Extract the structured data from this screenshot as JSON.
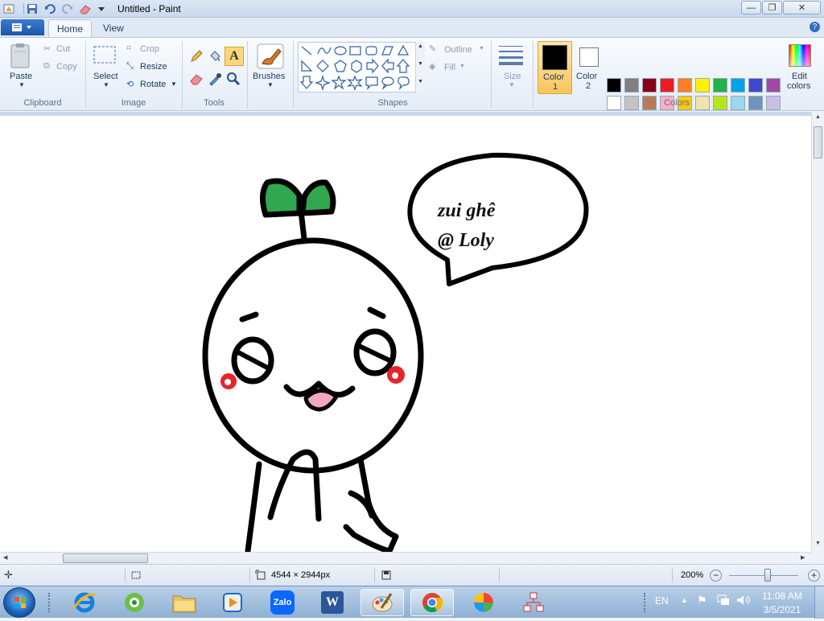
{
  "window": {
    "title": "Untitled - Paint",
    "controls": {
      "minimize": "—",
      "maximize": "❐",
      "close": "✕"
    }
  },
  "tabs": [
    {
      "label": "Home",
      "active": true
    },
    {
      "label": "View",
      "active": false
    }
  ],
  "ribbon": {
    "clipboard": {
      "group": "Clipboard",
      "paste": "Paste",
      "cut": "Cut",
      "copy": "Copy"
    },
    "image": {
      "group": "Image",
      "select": "Select",
      "crop": "Crop",
      "resize": "Resize",
      "rotate": "Rotate"
    },
    "tools": {
      "group": "Tools"
    },
    "brushes": {
      "label": "Brushes"
    },
    "shapes": {
      "group": "Shapes",
      "outline": "Outline",
      "fill": "Fill"
    },
    "size": {
      "label": "Size"
    },
    "colors": {
      "group": "Colors",
      "color1_line1": "Color",
      "color1_line2": "1",
      "color2_line1": "Color",
      "color2_line2": "2",
      "edit_line1": "Edit",
      "edit_line2": "colors",
      "color1": "#000000",
      "color2": "#ffffff",
      "palette_row1": [
        "#000000",
        "#7f7f7f",
        "#880015",
        "#ed1c24",
        "#ff7f27",
        "#fff200",
        "#22b14c",
        "#00a2e8",
        "#3f48cc",
        "#a349a4"
      ],
      "palette_row2": [
        "#ffffff",
        "#c3c3c3",
        "#b97a57",
        "#ffaec9",
        "#ffc90e",
        "#efe4b0",
        "#b5e61d",
        "#99d9ea",
        "#7092be",
        "#c8bfe7"
      ]
    }
  },
  "canvas": {
    "speech_line1": "zui ghê",
    "speech_line2": "@ Loly",
    "leaf_color": "#2fa84f",
    "cheek_color": "#e8232a",
    "tongue_color": "#f4a6c0"
  },
  "status": {
    "dimensions": "4544 × 2944px",
    "zoom": "200%"
  },
  "taskbar": {
    "apps": [
      "start-orb",
      "internet-explorer",
      "coccoc",
      "file-explorer",
      "media-player",
      "zalo",
      "word",
      "paint",
      "chrome",
      "color-app",
      "network-app"
    ],
    "zalo_label": "Zalo",
    "word_label": "W",
    "language": "EN",
    "time": "11:08 AM",
    "date": "3/5/2021"
  }
}
